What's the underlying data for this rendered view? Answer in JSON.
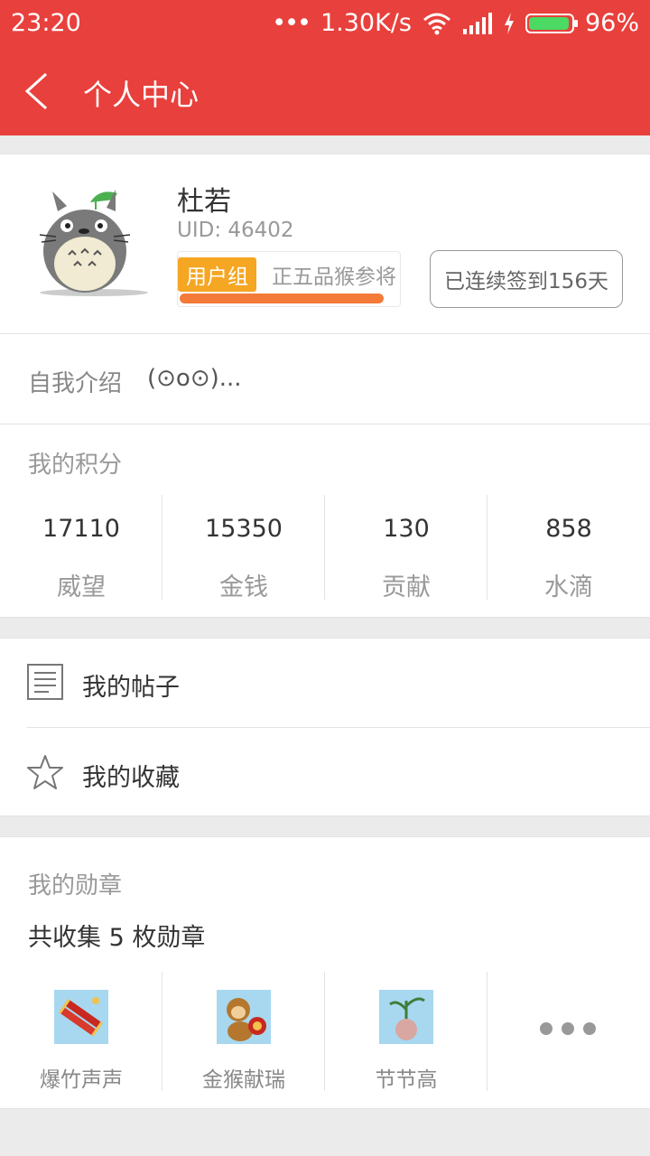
{
  "status_bar": {
    "time": "23:20",
    "network_speed": "1.30K/s",
    "battery_percent": "96%",
    "battery_level": 0.96
  },
  "header": {
    "title": "个人中心",
    "back_icon": "chevron-left-icon"
  },
  "profile": {
    "username": "杜若",
    "uid": "UID: 46402",
    "group_tag": "用户组",
    "group_name": "正五品猴参将",
    "group_progress": 0.92,
    "checkin": "已连续签到156天"
  },
  "intro": {
    "label": "自我介绍",
    "value": "(⊙o⊙)..."
  },
  "points": {
    "title": "我的积分",
    "items": [
      {
        "value": "17110",
        "label": "威望"
      },
      {
        "value": "15350",
        "label": "金钱"
      },
      {
        "value": "130",
        "label": "贡献"
      },
      {
        "value": "858",
        "label": "水滴"
      }
    ]
  },
  "menu": {
    "items": [
      {
        "label": "我的帖子",
        "icon": "document-icon"
      },
      {
        "label": "我的收藏",
        "icon": "star-icon"
      }
    ]
  },
  "medals": {
    "title": "我的勋章",
    "count_text": "共收集 5 枚勋章",
    "items": [
      {
        "label": "爆竹声声",
        "icon": "firecracker-icon"
      },
      {
        "label": "金猴献瑞",
        "icon": "golden-monkey-icon"
      },
      {
        "label": "节节高",
        "icon": "bamboo-plant-icon"
      }
    ],
    "more_icon": "more-dots-icon"
  },
  "colors": {
    "brand": "#e8403c",
    "tag": "#f5a623",
    "progress": "#f47a3a"
  }
}
